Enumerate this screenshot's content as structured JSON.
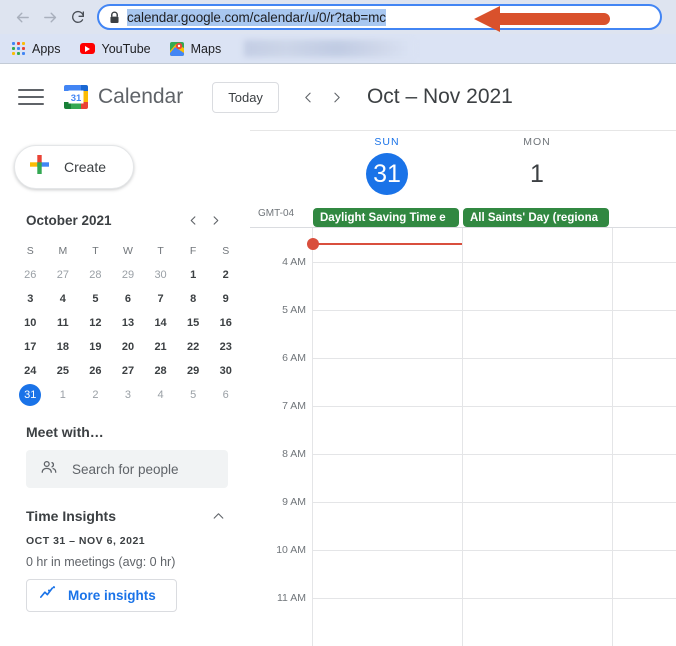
{
  "browser": {
    "back_icon": "arrow-left-icon",
    "forward_icon": "arrow-right-icon",
    "reload_icon": "reload-icon",
    "lock_icon": "lock-icon",
    "url": "calendar.google.com/calendar/u/0/r?tab=mc",
    "bookmarks": [
      {
        "label": "Apps",
        "icon": "apps-grid-icon"
      },
      {
        "label": "YouTube",
        "icon": "youtube-icon"
      },
      {
        "label": "Maps",
        "icon": "maps-pin-icon"
      }
    ],
    "annotation": {
      "shape": "red-arrow-pointing-left",
      "color": "#d9512c"
    }
  },
  "app": {
    "menu_icon": "hamburger-menu-icon",
    "logo_icon": "google-calendar-logo-icon",
    "logo_day": "31",
    "wordmark": "Calendar",
    "today_label": "Today",
    "prev_icon": "chevron-left-icon",
    "next_icon": "chevron-right-icon",
    "range_title": "Oct – Nov 2021"
  },
  "sidebar": {
    "create": {
      "label": "Create",
      "icon": "plus-icon"
    },
    "mini_calendar": {
      "title": "October 2021",
      "prev_icon": "chevron-left-icon",
      "next_icon": "chevron-right-icon",
      "dow": [
        "S",
        "M",
        "T",
        "W",
        "T",
        "F",
        "S"
      ],
      "weeks": [
        [
          {
            "d": "26",
            "muted": true
          },
          {
            "d": "27",
            "muted": true
          },
          {
            "d": "28",
            "muted": true
          },
          {
            "d": "29",
            "muted": true
          },
          {
            "d": "30",
            "muted": true
          },
          {
            "d": "1"
          },
          {
            "d": "2"
          }
        ],
        [
          {
            "d": "3"
          },
          {
            "d": "4"
          },
          {
            "d": "5"
          },
          {
            "d": "6"
          },
          {
            "d": "7"
          },
          {
            "d": "8"
          },
          {
            "d": "9"
          }
        ],
        [
          {
            "d": "10"
          },
          {
            "d": "11"
          },
          {
            "d": "12"
          },
          {
            "d": "13"
          },
          {
            "d": "14"
          },
          {
            "d": "15"
          },
          {
            "d": "16"
          }
        ],
        [
          {
            "d": "17"
          },
          {
            "d": "18"
          },
          {
            "d": "19"
          },
          {
            "d": "20"
          },
          {
            "d": "21"
          },
          {
            "d": "22"
          },
          {
            "d": "23"
          }
        ],
        [
          {
            "d": "24"
          },
          {
            "d": "25"
          },
          {
            "d": "26"
          },
          {
            "d": "27"
          },
          {
            "d": "28"
          },
          {
            "d": "29"
          },
          {
            "d": "30"
          }
        ],
        [
          {
            "d": "31",
            "today": true
          },
          {
            "d": "1",
            "muted": true
          },
          {
            "d": "2",
            "muted": true
          },
          {
            "d": "3",
            "muted": true
          },
          {
            "d": "4",
            "muted": true
          },
          {
            "d": "5",
            "muted": true
          },
          {
            "d": "6",
            "muted": true
          }
        ]
      ]
    },
    "meet_with": {
      "title": "Meet with…",
      "search_placeholder": "Search for people",
      "search_icon": "people-icon"
    },
    "time_insights": {
      "title": "Time Insights",
      "collapse_icon": "chevron-up-icon",
      "range": "OCT 31 – NOV 6, 2021",
      "meetings": "0 hr in meetings (avg: 0 hr)",
      "more_button": "More insights",
      "more_icon": "insights-chart-icon"
    }
  },
  "grid": {
    "timezone": "GMT-04",
    "days": [
      {
        "dow": "SUN",
        "num": "31",
        "today": true
      },
      {
        "dow": "MON",
        "num": "1",
        "today": false
      }
    ],
    "all_day_events": [
      {
        "title": "Daylight Saving Time e",
        "color": "#318841",
        "day": 0
      },
      {
        "title": "All Saints' Day (regiona",
        "color": "#318841",
        "day": 1
      }
    ],
    "hours": [
      "4 AM",
      "5 AM",
      "6 AM",
      "7 AM",
      "8 AM",
      "9 AM",
      "10 AM",
      "11 AM"
    ],
    "now_indicator": {
      "color": "#d94f3d",
      "day": 0
    }
  }
}
